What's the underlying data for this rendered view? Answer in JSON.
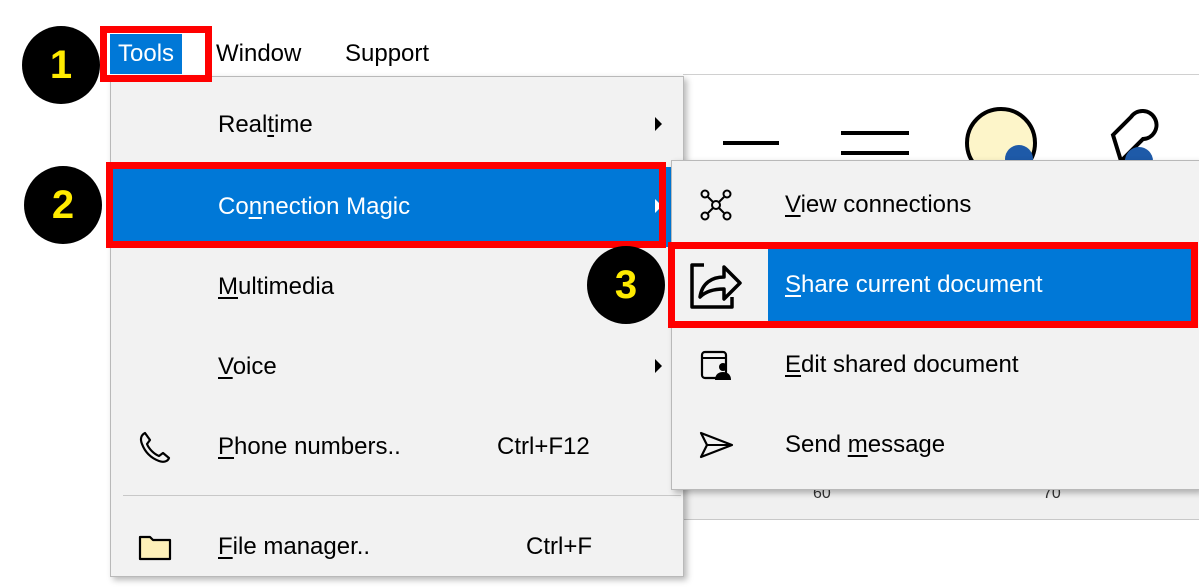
{
  "menubar": {
    "items": [
      {
        "label": "Tools",
        "active": true
      },
      {
        "label": "Window",
        "active": false
      },
      {
        "label": "Support",
        "active": false
      }
    ]
  },
  "tools_menu": {
    "items": [
      {
        "label_pre": "Real",
        "label_u": "t",
        "label_post": "ime",
        "has_submenu": true
      },
      {
        "label_pre": "Co",
        "label_u": "n",
        "label_post": "nection Magic",
        "has_submenu": true,
        "highlighted": true
      },
      {
        "label_pre": "",
        "label_u": "M",
        "label_post": "ultimedia",
        "has_submenu": false
      },
      {
        "label_pre": "",
        "label_u": "V",
        "label_post": "oice",
        "has_submenu": true
      },
      {
        "label_pre": "",
        "label_u": "P",
        "label_post": "hone numbers..",
        "shortcut": "Ctrl+F12",
        "icon": "phone-icon"
      },
      {
        "label_pre": "",
        "label_u": "F",
        "label_post": "ile manager..",
        "shortcut": "Ctrl+F",
        "icon": "folder-icon"
      }
    ]
  },
  "connection_submenu": {
    "items": [
      {
        "label_pre": "",
        "label_u": "V",
        "label_post": "iew connections",
        "icon": "network-icon"
      },
      {
        "label_pre": "",
        "label_u": "S",
        "label_post": "hare current document",
        "icon": "share-icon",
        "highlighted": true
      },
      {
        "label_pre": "",
        "label_u": "E",
        "label_post": "dit shared document",
        "icon": "edit-shared-document-icon"
      },
      {
        "label_pre": "Send ",
        "label_u": "m",
        "label_post": "essage",
        "icon": "send-icon"
      }
    ]
  },
  "ruler": {
    "marks": [
      "60",
      "70"
    ]
  },
  "callouts": [
    "1",
    "2",
    "3"
  ],
  "colors": {
    "highlight": "#0078d7",
    "callout_border": "#ff0000",
    "badge_bg": "#000000",
    "badge_text": "#ffeb00",
    "menu_bg": "#f2f2f2"
  }
}
